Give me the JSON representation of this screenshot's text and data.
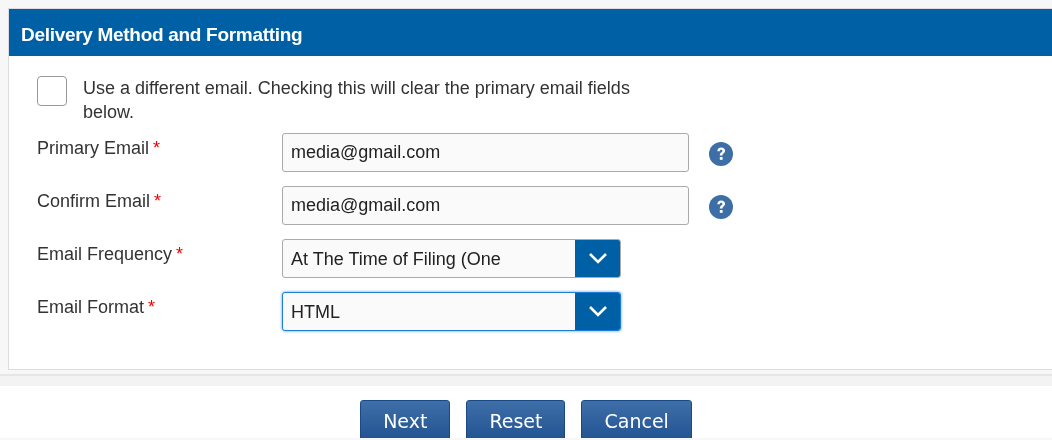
{
  "panel": {
    "title": "Delivery Method and Formatting"
  },
  "option": {
    "label": "Use a different email. Checking this will clear the primary email fields below.",
    "checked": false
  },
  "fields": [
    {
      "kind": "text",
      "label": "Primary Email",
      "required_mark": "*",
      "value": "media@gmail.com",
      "help": true,
      "focused": false
    },
    {
      "kind": "text",
      "label": "Confirm Email",
      "required_mark": "*",
      "value": "media@gmail.com",
      "help": true,
      "focused": false
    },
    {
      "kind": "select",
      "label": "Email Frequency",
      "required_mark": "*",
      "value": "At The Time of Filing (One",
      "focused": false
    },
    {
      "kind": "select",
      "label": "Email Format",
      "required_mark": "*",
      "value": "HTML",
      "focused": true
    }
  ],
  "buttons": [
    "Next",
    "Reset",
    "Cancel"
  ]
}
